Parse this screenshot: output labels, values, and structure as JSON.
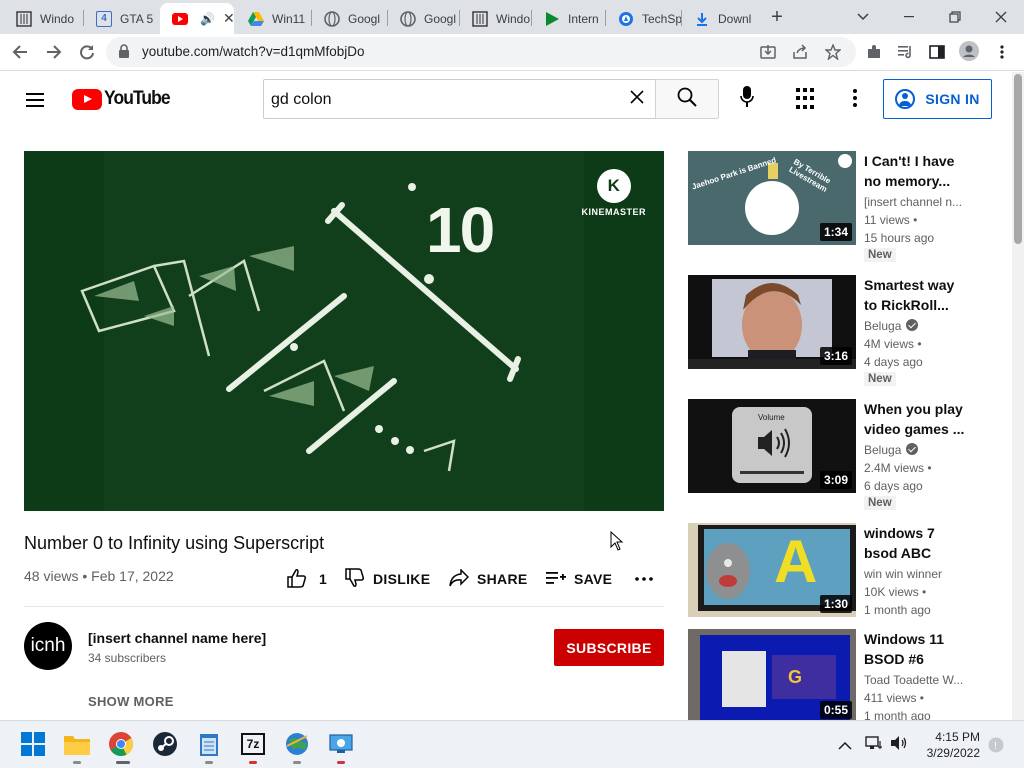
{
  "browser": {
    "tabs": [
      {
        "title": "Windo",
        "icon": "windows-doc-icon"
      },
      {
        "title": "GTA 5",
        "icon": "gta-icon"
      },
      {
        "title": "",
        "icon": "youtube-icon",
        "active": true
      },
      {
        "title": "Win11",
        "icon": "google-drive-icon"
      },
      {
        "title": "Googl",
        "icon": "globe-icon"
      },
      {
        "title": "Googl",
        "icon": "globe-icon"
      },
      {
        "title": "Windo",
        "icon": "windows-doc-icon"
      },
      {
        "title": "Intern",
        "icon": "play-green-icon"
      },
      {
        "title": "TechSp",
        "icon": "techspot-icon"
      },
      {
        "title": "Downl",
        "icon": "download-icon"
      }
    ],
    "url": "youtube.com/watch?v=d1qmMfobjDo"
  },
  "youtube": {
    "logo_text": "YouTube",
    "search_query": "gd colon",
    "sign_in_label": "SIGN IN"
  },
  "video": {
    "overlay_number": "10",
    "watermark": "KINEMASTER",
    "title": "Number 0 to Infinity using Superscript",
    "meta": "48 views • Feb 17, 2022",
    "like_count": "1",
    "dislike_label": "DISLIKE",
    "share_label": "SHARE",
    "save_label": "SAVE"
  },
  "channel": {
    "avatar_text": "icnh",
    "name": "[insert channel name here]",
    "subscribers": "34 subscribers",
    "subscribe_label": "SUBSCRIBE",
    "show_more_label": "SHOW MORE"
  },
  "recommendations": [
    {
      "title": "I Can't! I have no memory...",
      "channel": "[insert channel n...",
      "views": "11 views •",
      "age": "15 hours ago",
      "badge": "New",
      "duration": "1:34",
      "verified": false,
      "thumb_text_1": "Jaehoo Park is Banned",
      "thumb_text_2": "By Terrible Livestream"
    },
    {
      "title": "Smartest way to RickRoll...",
      "channel": "Beluga",
      "views": "4M views •",
      "age": "4 days ago",
      "badge": "New",
      "duration": "3:16",
      "verified": true
    },
    {
      "title": "When you play video games ...",
      "channel": "Beluga",
      "views": "2.4M views •",
      "age": "6 days ago",
      "badge": "New",
      "duration": "3:09",
      "verified": true,
      "thumb_text_1": "Volume"
    },
    {
      "title": "windows 7 bsod ABC",
      "channel": "win win winner",
      "views": "10K views •",
      "age": "1 month ago",
      "badge": "",
      "duration": "1:30",
      "verified": false,
      "thumb_text_1": "A"
    },
    {
      "title": "Windows 11 BSOD #6",
      "channel": "Toad Toadette W...",
      "views": "411 views •",
      "age": "1 month ago",
      "badge": "",
      "duration": "0:55",
      "verified": false
    }
  ],
  "taskbar": {
    "apps": [
      "windows-start-icon",
      "file-explorer-icon",
      "chrome-icon",
      "steam-icon",
      "notepad-icon",
      "7zip-icon",
      "network-globe-icon",
      "remote-desktop-icon"
    ],
    "time": "4:15 PM",
    "date": "3/29/2022",
    "sevenzip_label": "7z"
  }
}
